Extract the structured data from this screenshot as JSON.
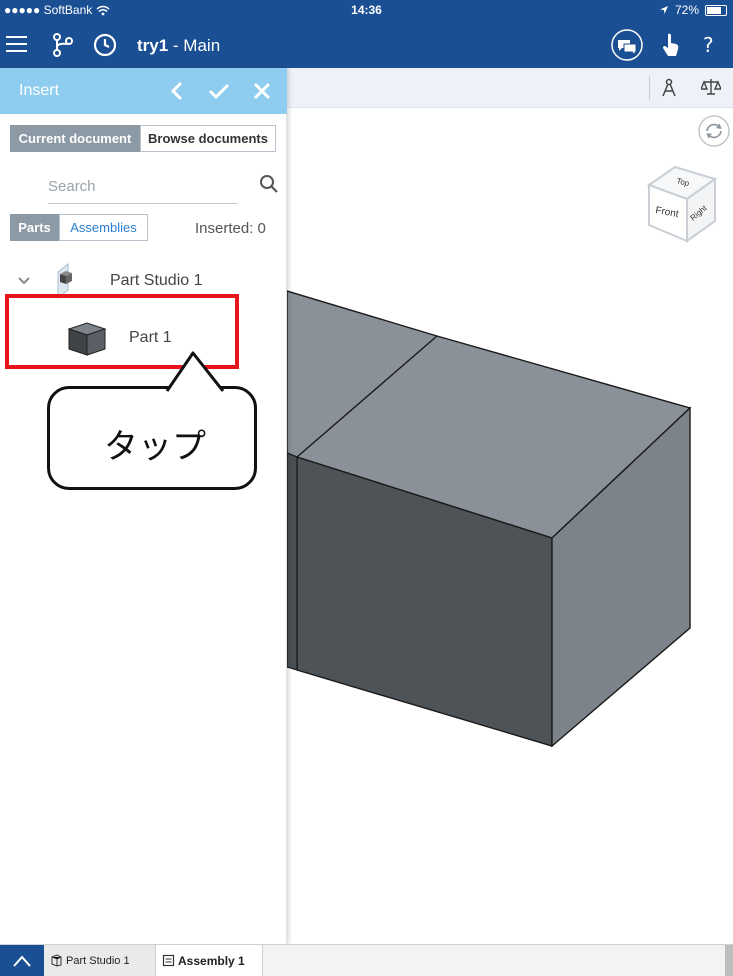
{
  "status_bar": {
    "carrier": "●●●●● SoftBank",
    "time": "14:36",
    "battery": "72%"
  },
  "header": {
    "doc_name": "try1",
    "separator": " - ",
    "branch": "Main"
  },
  "insert_panel": {
    "title": "Insert",
    "doc_tabs": [
      "Current document",
      "Browse documents"
    ],
    "search_placeholder": "Search",
    "type_tabs": [
      "Parts",
      "Assemblies"
    ],
    "inserted_label": "Inserted: 0",
    "tree": {
      "studio": "Part Studio 1",
      "part": "Part 1"
    }
  },
  "view_cube": {
    "top": "Top",
    "front": "Front",
    "right": "Right"
  },
  "callout": {
    "text": "タップ"
  },
  "bottom_tabs": [
    "Part Studio 1",
    "Assembly 1"
  ],
  "colors": {
    "header_blue": "#1b4f93",
    "panel_header": "#8ecdf0",
    "highlight_red": "#e8141b",
    "part_dark": "#4e5358",
    "part_top": "#8a9198"
  },
  "icons": [
    "menu-icon",
    "branch-icon",
    "history-icon",
    "comments-icon",
    "touch-icon",
    "help-icon",
    "back-icon",
    "check-icon",
    "close-icon",
    "search-icon",
    "chevron-down-icon",
    "part-studio-icon",
    "part-icon",
    "mass-properties-icon",
    "measure-icon",
    "view-rotate-icon"
  ]
}
